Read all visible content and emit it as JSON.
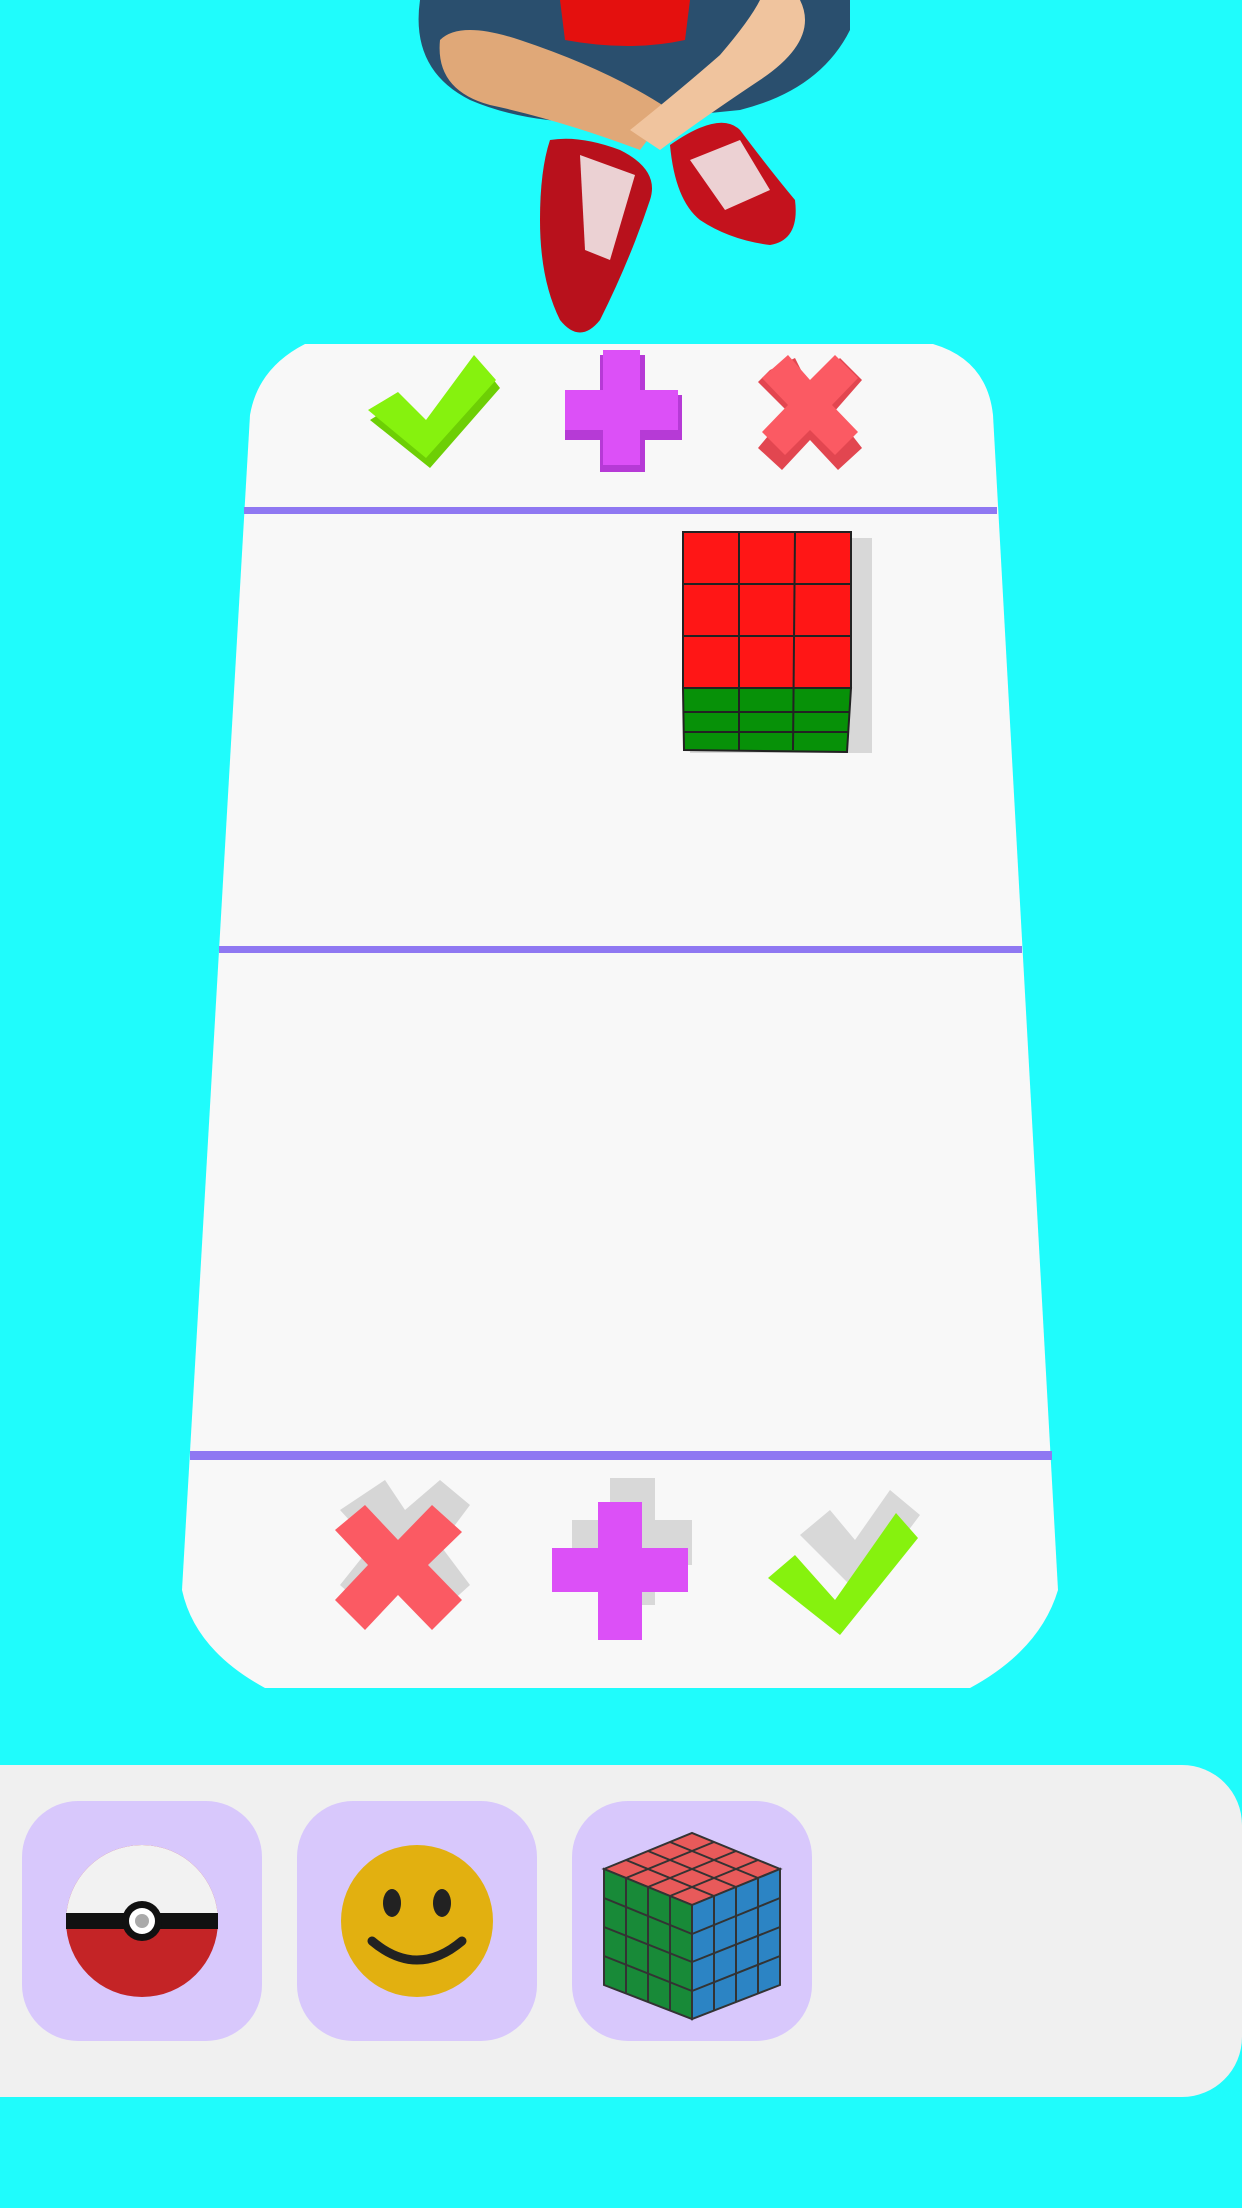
{
  "scene": {
    "background_color": "#1ffcfc",
    "board_color": "#f8f8f8",
    "divider_color": "#8f78f2"
  },
  "board": {
    "top_row_icons": [
      "check-icon",
      "plus-icon",
      "cross-icon"
    ],
    "bottom_row_icons": [
      "cross-icon",
      "plus-icon",
      "check-icon"
    ],
    "icon_colors": {
      "check": "#86f20e",
      "plus": "#dc50f7",
      "cross": "#fb5a63"
    },
    "falling_piece": {
      "name": "cube",
      "top_color": "#ff1616",
      "bottom_color": "#079108"
    }
  },
  "tray": {
    "items": [
      {
        "name": "pokeball",
        "icon": "pokeball-icon"
      },
      {
        "name": "smiley",
        "icon": "smiley-icon"
      },
      {
        "name": "rubiks-cube",
        "icon": "rubiks-cube-icon"
      }
    ]
  }
}
